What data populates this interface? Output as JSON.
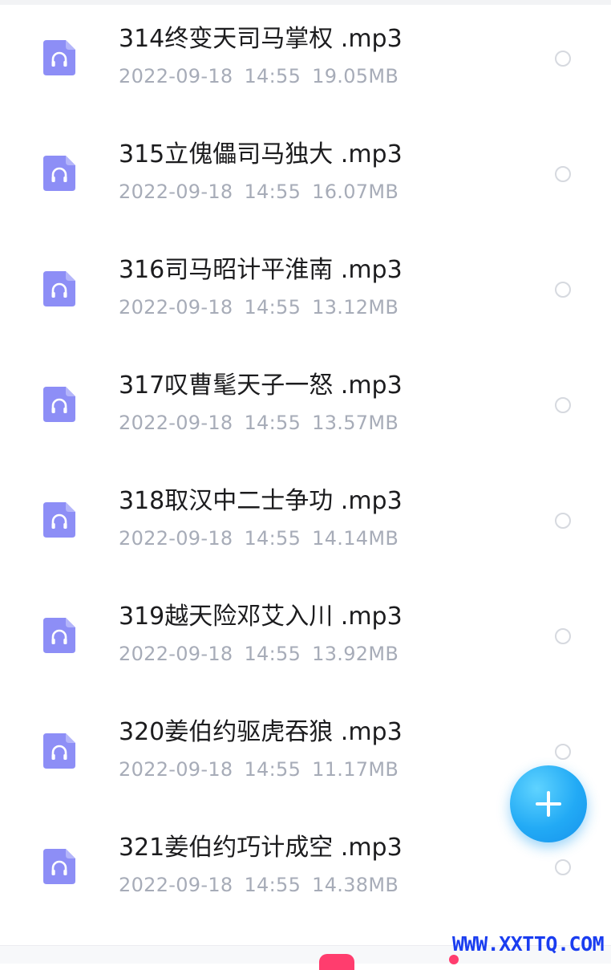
{
  "colors": {
    "accent": "#22aaf5",
    "icon": "#8d8ef6",
    "title_text": "#1c1c1e",
    "meta_text": "#a7acb8",
    "watermark": "#1a3df0",
    "tab_badge": "#ff3d6e"
  },
  "files": [
    {
      "name": "314终变天司马掌权 .mp3",
      "date": "2022-09-18",
      "time": "14:55",
      "size": "19.05MB",
      "icon": "headphones-icon",
      "selected": false
    },
    {
      "name": "315立傀儡司马独大 .mp3",
      "date": "2022-09-18",
      "time": "14:55",
      "size": "16.07MB",
      "icon": "headphones-icon",
      "selected": false
    },
    {
      "name": "316司马昭计平淮南 .mp3",
      "date": "2022-09-18",
      "time": "14:55",
      "size": "13.12MB",
      "icon": "headphones-icon",
      "selected": false
    },
    {
      "name": "317叹曹髦天子一怒 .mp3",
      "date": "2022-09-18",
      "time": "14:55",
      "size": "13.57MB",
      "icon": "headphones-icon",
      "selected": false
    },
    {
      "name": "318取汉中二士争功 .mp3",
      "date": "2022-09-18",
      "time": "14:55",
      "size": "14.14MB",
      "icon": "headphones-icon",
      "selected": false
    },
    {
      "name": "319越天险邓艾入川 .mp3",
      "date": "2022-09-18",
      "time": "14:55",
      "size": "13.92MB",
      "icon": "headphones-icon",
      "selected": false
    },
    {
      "name": "320姜伯约驱虎吞狼 .mp3",
      "date": "2022-09-18",
      "time": "14:55",
      "size": "11.17MB",
      "icon": "headphones-icon",
      "selected": false
    },
    {
      "name": "321姜伯约巧计成空 .mp3",
      "date": "2022-09-18",
      "time": "14:55",
      "size": "14.38MB",
      "icon": "headphones-icon",
      "selected": false
    }
  ],
  "fab": {
    "icon": "plus-icon"
  },
  "watermark": {
    "text": "WWW.XXTTQ.COM"
  }
}
